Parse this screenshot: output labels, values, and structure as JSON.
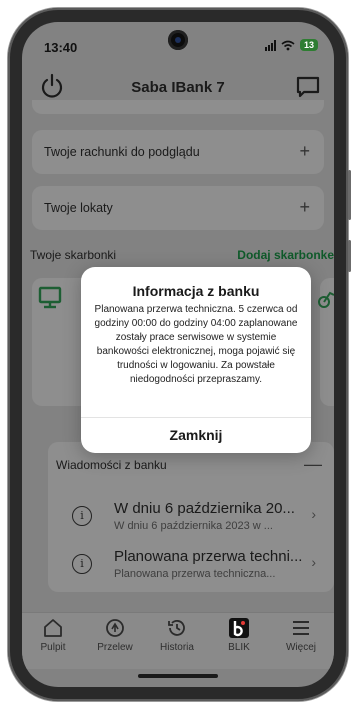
{
  "status_bar": {
    "time": "13:40",
    "battery": "13"
  },
  "header": {
    "title": "Saba IBank 7"
  },
  "accounts_preview": {
    "label": "Twoje rachunki do podglądu",
    "action": "+"
  },
  "deposits": {
    "label": "Twoje lokaty",
    "action": "+"
  },
  "savings": {
    "label": "Twoje skarbonki",
    "add_label": "Dodaj skarbonke"
  },
  "messages": {
    "title": "Wiadomości z banku",
    "collapse": "—",
    "items": [
      {
        "title": "W dniu 6 października 20...",
        "preview": "W dniu 6 października 2023 w ..."
      },
      {
        "title": "Planowana przerwa techni...",
        "preview": "Planowana przerwa techniczna..."
      }
    ]
  },
  "bottom_nav": [
    {
      "label": "Pulpit",
      "icon": "home-icon"
    },
    {
      "label": "Przelew",
      "icon": "transfer-icon"
    },
    {
      "label": "Historia",
      "icon": "history-icon"
    },
    {
      "label": "BLIK",
      "icon": "blik-icon"
    },
    {
      "label": "Więcej",
      "icon": "menu-icon"
    }
  ],
  "dialog": {
    "title": "Informacja z banku",
    "message": "Planowana przerwa techniczna. 5 czerwca od godziny 00:00 do godziny 04:00 zaplanowane zostały prace serwisowe w systemie bankowości elektronicznej, moga pojawić się trudności w logowaniu. Za powstałe niedogodności przepraszamy.",
    "button": "Zamknij"
  },
  "colors": {
    "accent_green": "#0f5a2a",
    "overlay_bg": "#828282",
    "dialog_bg": "#ffffff"
  }
}
